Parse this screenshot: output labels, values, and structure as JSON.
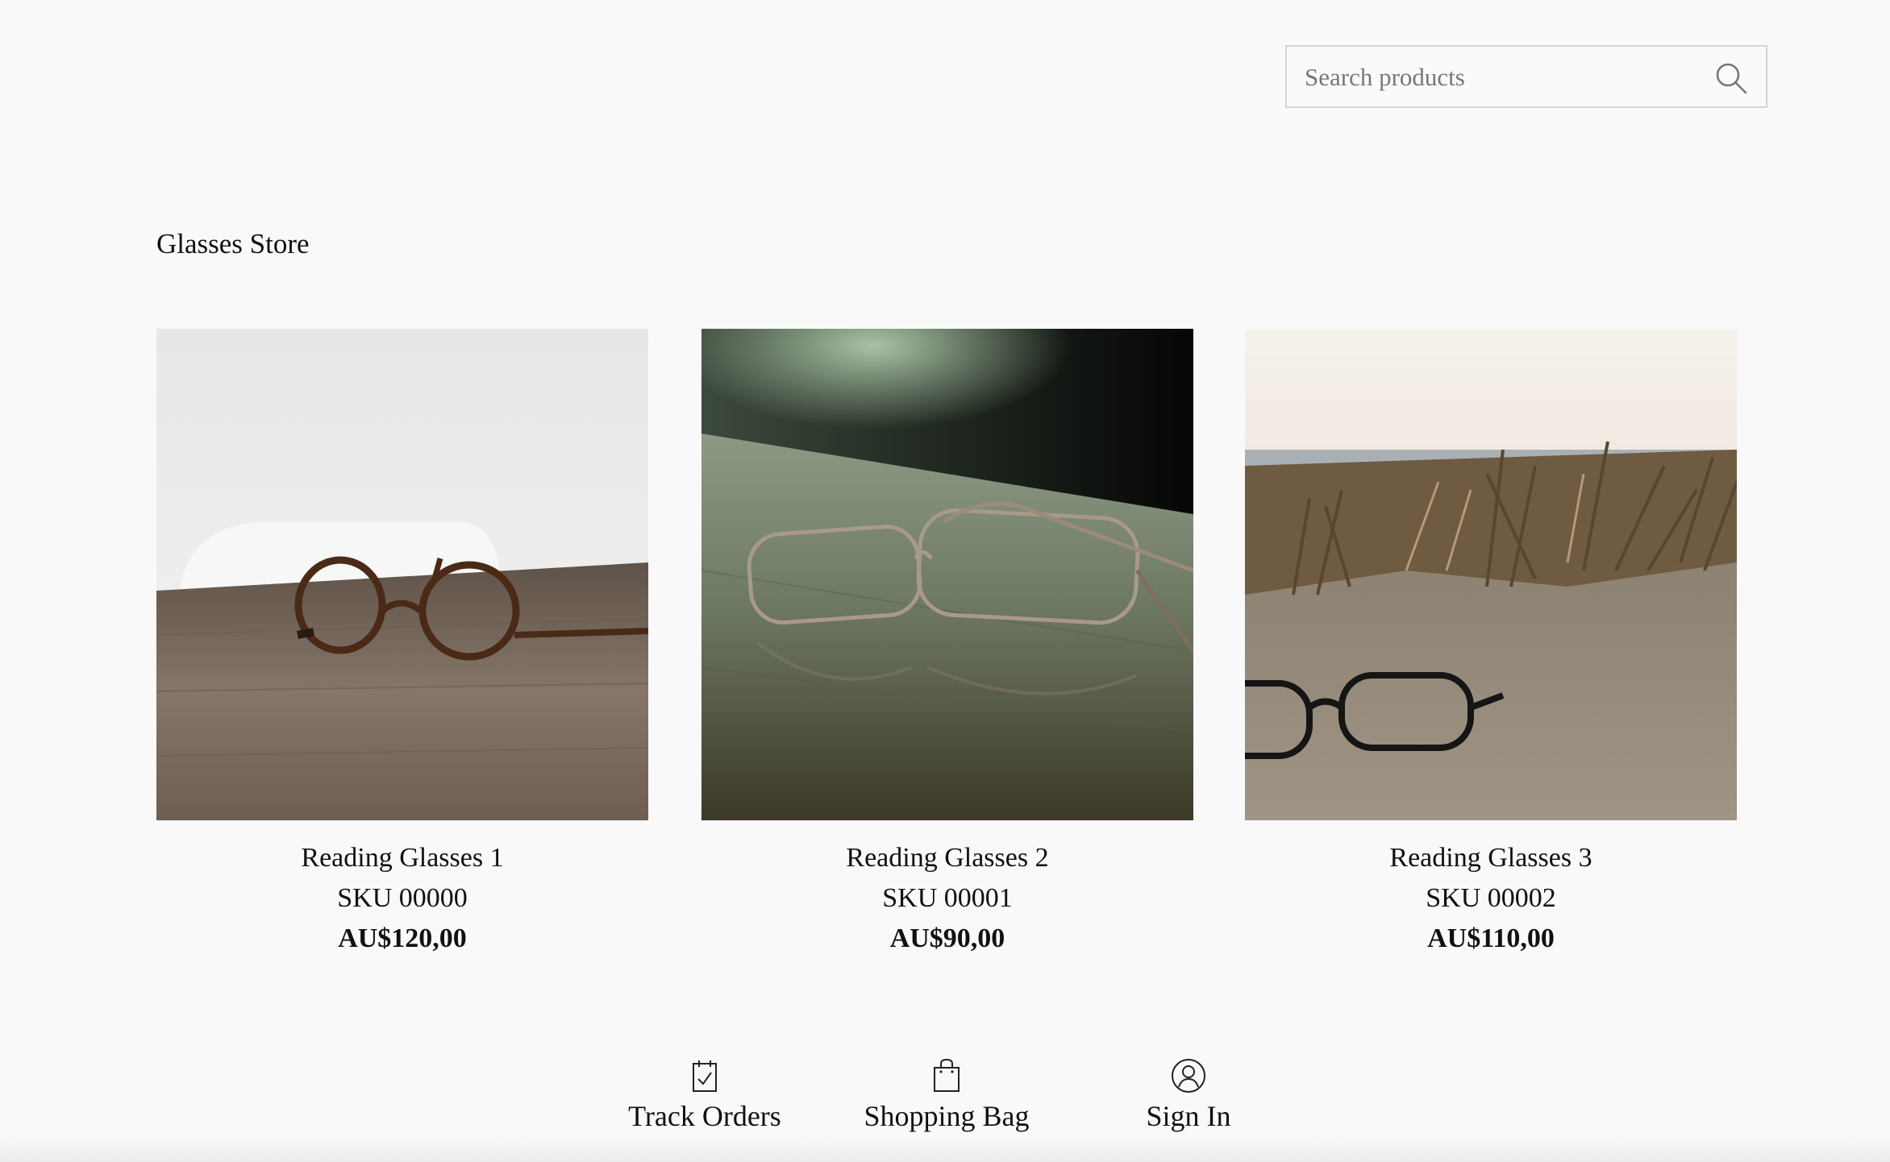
{
  "search": {
    "placeholder": "Search products",
    "icon": "search-icon"
  },
  "store": {
    "title": "Glasses Store"
  },
  "products": [
    {
      "name": "Reading Glasses 1",
      "sku": "SKU 00000",
      "price": "AU$120,00"
    },
    {
      "name": "Reading Glasses 2",
      "sku": "SKU 00001",
      "price": "AU$90,00"
    },
    {
      "name": "Reading Glasses 3",
      "sku": "SKU 00002",
      "price": "AU$110,00"
    }
  ],
  "nav": {
    "items": [
      {
        "label": "Track Orders",
        "icon": "track-orders-icon"
      },
      {
        "label": "Shopping Bag",
        "icon": "shopping-bag-icon"
      },
      {
        "label": "Sign In",
        "icon": "user-icon"
      }
    ]
  },
  "colors": {
    "background": "#f9f9f9",
    "text": "#111111",
    "border": "#d4d4d4"
  }
}
